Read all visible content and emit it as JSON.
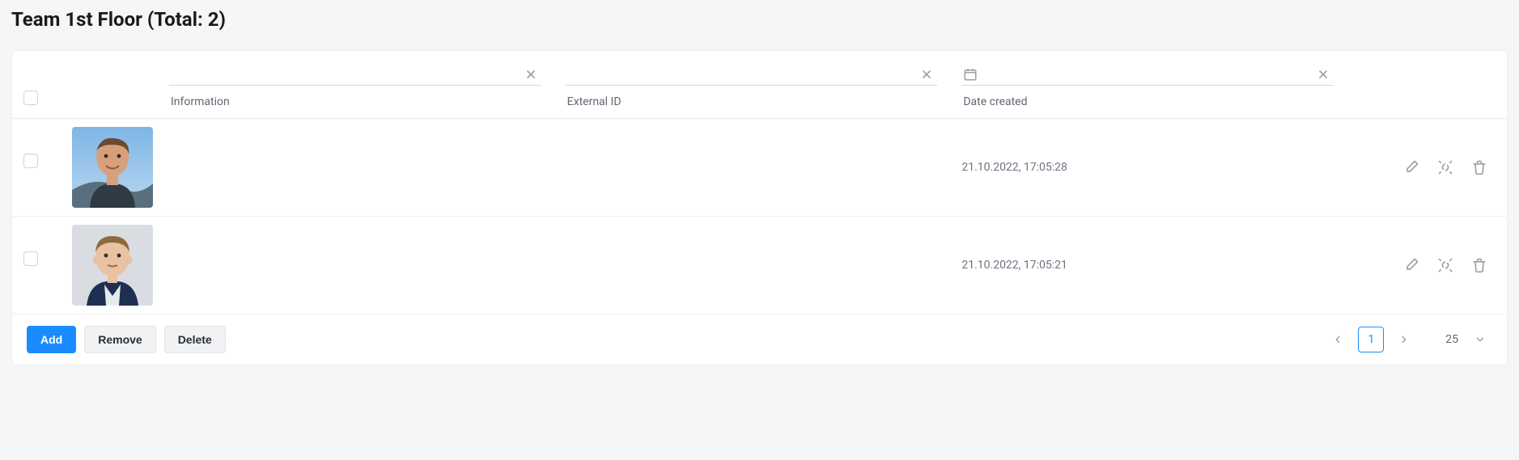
{
  "title": "Team 1st Floor (Total: 2)",
  "columns": {
    "information": "Information",
    "external_id": "External ID",
    "date_created": "Date created"
  },
  "filters": {
    "information": "",
    "external_id": "",
    "date_created": ""
  },
  "rows": [
    {
      "information": "",
      "external_id": "",
      "date_created": "21.10.2022, 17:05:28"
    },
    {
      "information": "",
      "external_id": "",
      "date_created": "21.10.2022, 17:05:21"
    }
  ],
  "buttons": {
    "add": "Add",
    "remove": "Remove",
    "delete": "Delete"
  },
  "pagination": {
    "current": "1",
    "page_size": "25"
  }
}
